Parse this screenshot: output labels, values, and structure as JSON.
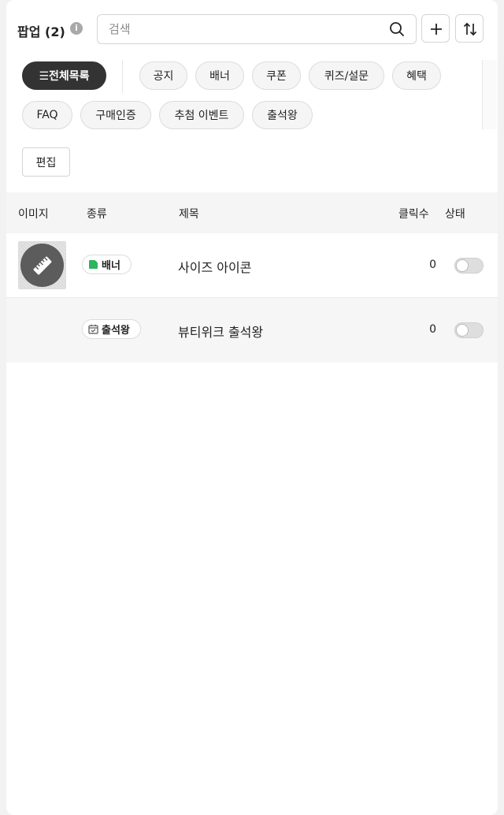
{
  "header": {
    "title": "팝업 (2)",
    "info_icon": "info-icon",
    "search": {
      "placeholder": "검색",
      "value": ""
    }
  },
  "filters": {
    "all_label": "☰전체목록",
    "chips": [
      "공지",
      "배너",
      "쿠폰",
      "퀴즈/설문",
      "혜택",
      "FAQ",
      "구매인증",
      "추첨 이벤트",
      "출석왕"
    ]
  },
  "edit_label": "편집",
  "table": {
    "columns": [
      "이미지",
      "종류",
      "제목",
      "클릭수",
      "상태"
    ],
    "rows": [
      {
        "type": "배너",
        "type_icon": "banner-icon",
        "type_color": "#2db45c",
        "title": "사이즈 아이콘",
        "clicks": "0",
        "status_on": false,
        "image_icon": "ruler-icon"
      },
      {
        "type": "출석왕",
        "type_icon": "calendar-check-icon",
        "title": "뷰티위크 출석왕",
        "clicks": "0",
        "status_on": false
      }
    ]
  },
  "colors": {
    "active_chip": "#333333",
    "chip_bg": "#f5f5f5",
    "banner_green": "#2db45c"
  }
}
